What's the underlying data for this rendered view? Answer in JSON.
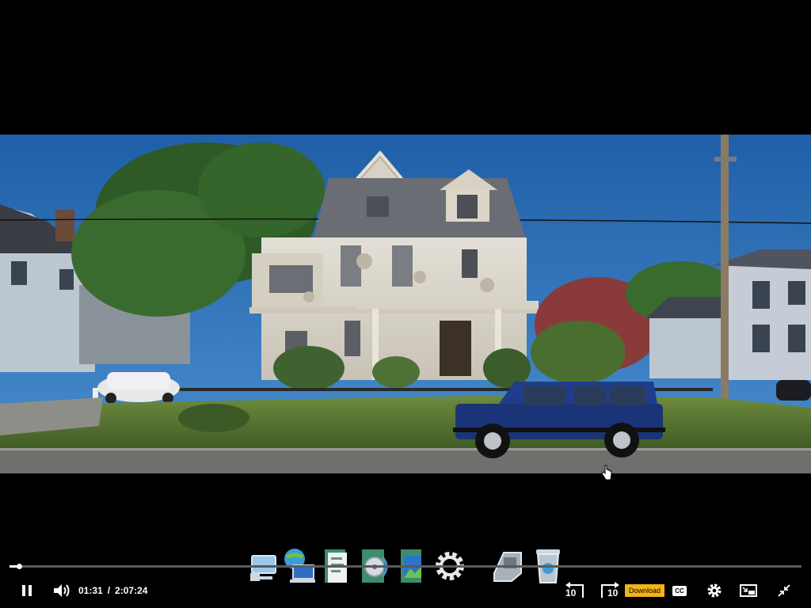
{
  "player": {
    "current_time": "01:31",
    "separator": "/",
    "duration": "2:07:24",
    "progress_fraction": 0.012,
    "download_label": "Download",
    "cc_label": "CC",
    "rewind_seconds": "10",
    "forward_seconds": "10"
  },
  "dock": {
    "icons": [
      "computer-icon",
      "network-icon",
      "document-icon",
      "media-player-icon",
      "photo-gallery-icon",
      "settings-gear-icon",
      "scanner-icon",
      "recycle-bin-icon"
    ]
  },
  "colors": {
    "sky": "#2f73b8",
    "download_badge": "#f2b418",
    "jeep": "#1a3478"
  }
}
